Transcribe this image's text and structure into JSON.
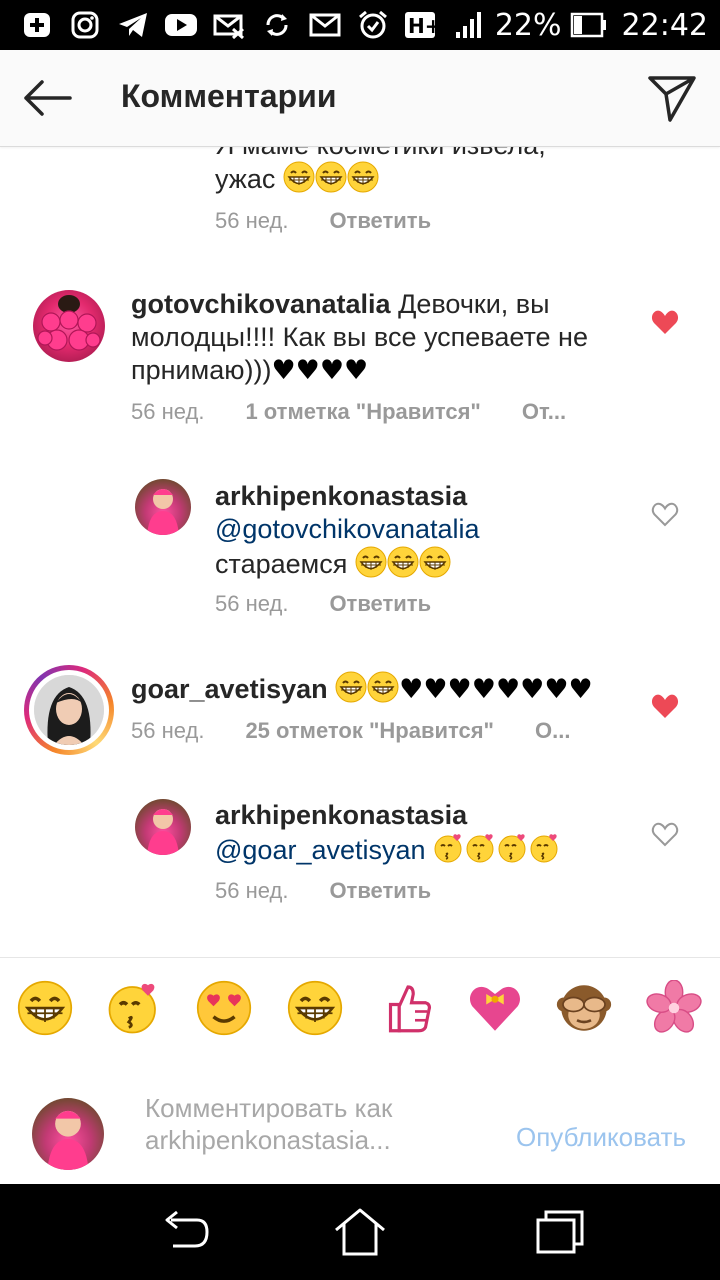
{
  "status_bar": {
    "battery_percent": "22%",
    "time": "22:42",
    "network": "H+",
    "icons": [
      "plus-box-icon",
      "instagram-icon",
      "telegram-icon",
      "youtube-icon",
      "mail-off-icon",
      "sync-icon",
      "mail-icon",
      "alarm-icon",
      "hplus-icon",
      "signal-icon",
      "battery-icon"
    ]
  },
  "header": {
    "title": "Комментарии",
    "back_icon": "arrow-left-icon",
    "send_icon": "direct-send-icon"
  },
  "comments": [
    {
      "text_line1": "Я маме косметики извела,",
      "text_line2": "ужас",
      "time": "56 нед.",
      "reply_label": "Ответить"
    },
    {
      "username": "gotovchikovanatalia",
      "text_part1": " Девочки,  вы",
      "text_line2": "молодцы!!!! Как вы все успеваете не",
      "text_line3": "прнимаю)))",
      "hearts": "♥♥♥♥",
      "time": "56 нед.",
      "likes_label": "1 отметка \"Нравится\"",
      "reply_label": "От...",
      "liked": true
    },
    {
      "username": "arkhipenkonastasia",
      "mention": "@gotovchikovanatalia",
      "text": "стараемся",
      "time": "56 нед.",
      "reply_label": "Ответить",
      "liked": false
    },
    {
      "username": "goar_avetisyan",
      "hearts": "♥♥♥♥♥♥♥♥",
      "time": "56 нед.",
      "likes_label": "25 отметок \"Нравится\"",
      "reply_label": "О...",
      "liked": true
    },
    {
      "username": "arkhipenkonastasia",
      "mention": "@goar_avetisyan",
      "time": "56 нед.",
      "reply_label": "Ответить",
      "liked": false
    }
  ],
  "emoji_bar": [
    "tears-of-joy-emoji",
    "kissing-heart-emoji",
    "heart-eyes-emoji",
    "grinning-emoji",
    "thumbs-up-emoji",
    "heart-ribbon-emoji",
    "see-no-evil-monkey-emoji",
    "cherry-blossom-emoji"
  ],
  "comment_input": {
    "placeholder_line1": "Комментировать как",
    "placeholder_line2": "arkhipenkonastasia...",
    "publish_label": "Опубликовать"
  },
  "navigation": [
    "back-nav-icon",
    "home-nav-icon",
    "recents-nav-icon"
  ],
  "colors": {
    "like_red": "#ed4956",
    "mention_blue": "#003569",
    "publish_blue": "#9bc4ee",
    "meta_gray": "#999999"
  }
}
